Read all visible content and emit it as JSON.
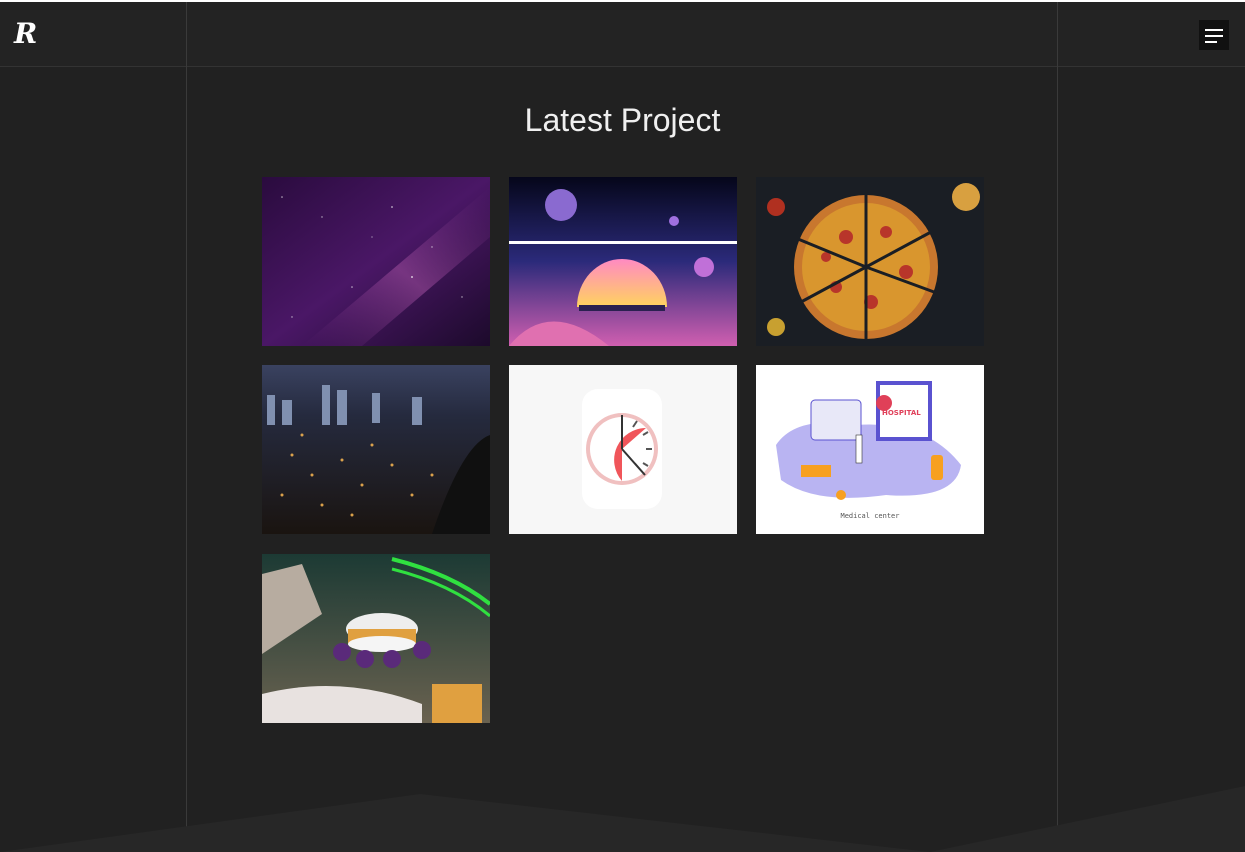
{
  "header": {
    "logo_text": "R",
    "menu_icon": "hamburger-menu-icon"
  },
  "main": {
    "title": "Latest Project"
  },
  "projects": [
    {
      "subject": "purple galaxy night sky"
    },
    {
      "subject": "retro space dome illustration"
    },
    {
      "subject": "sliced pizza on dark table"
    },
    {
      "subject": "city lights at night"
    },
    {
      "subject": "red clock illustration"
    },
    {
      "subject": "isometric medical center",
      "caption": "Medical center",
      "sign": "HOSPITAL"
    },
    {
      "subject": "3d rover robot scene"
    }
  ]
}
